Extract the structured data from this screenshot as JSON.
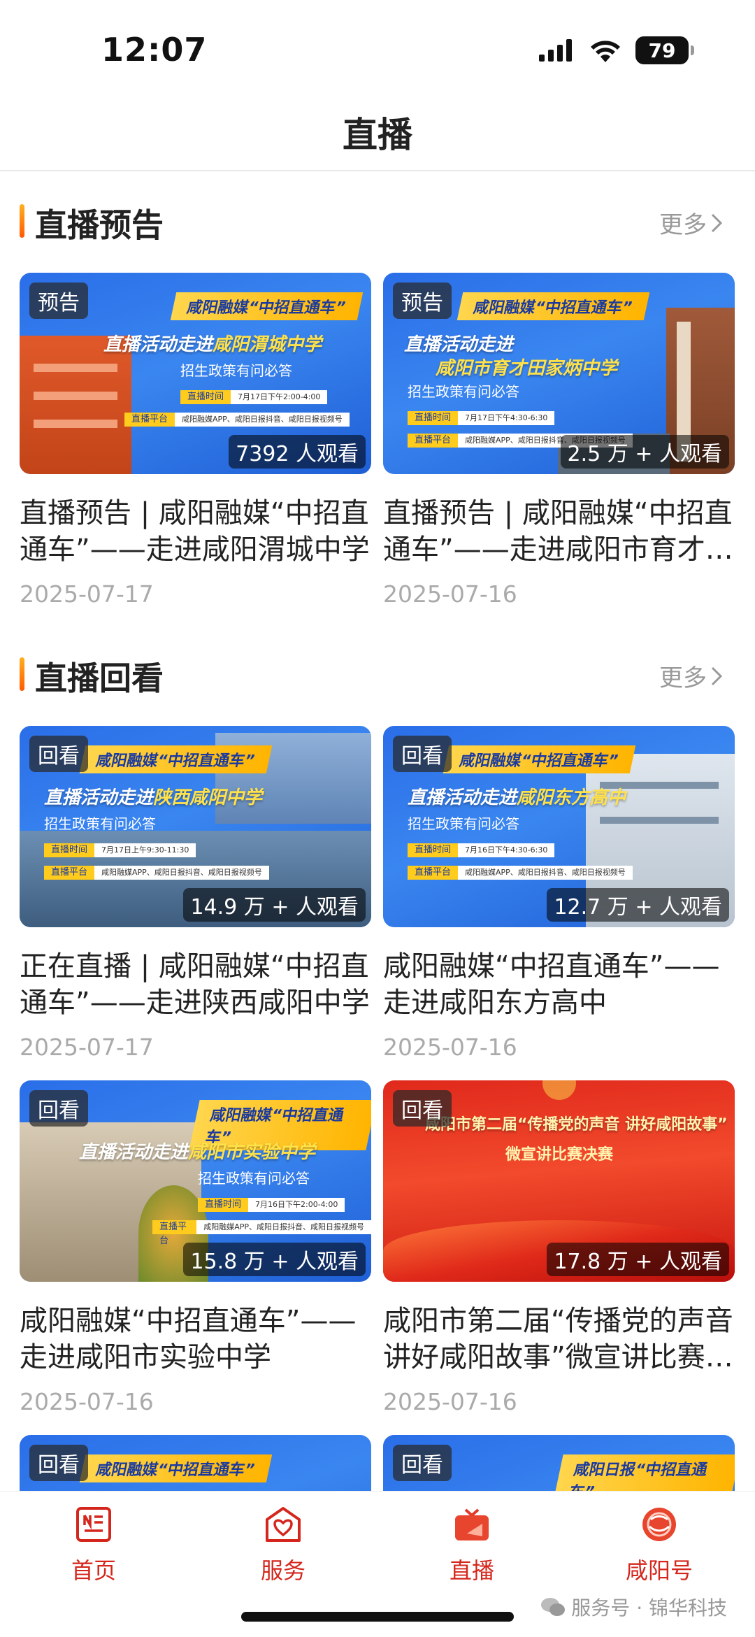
{
  "status": {
    "time": "12:07",
    "battery": "79"
  },
  "nav": {
    "title": "直播"
  },
  "sections": {
    "preview": {
      "title": "直播预告",
      "more": "更多"
    },
    "replay": {
      "title": "直播回看",
      "more": "更多"
    }
  },
  "cards": [
    {
      "badge": "预告",
      "viewers": "7392 人观看",
      "title": "直播预告 | 咸阳融媒“中招直通车”——走进咸阳渭城中学",
      "date": "2025-07-17",
      "banner": {
        "tag": "咸阳融媒“中招直通车”",
        "headline_prefix": "直播活动走进",
        "headline_highlight": "咸阳渭城中学",
        "subline": "招生政策有问必答",
        "time_label": "直播时间",
        "time_value": "7月17日下午2:00-4:00",
        "platform_label": "直播平台",
        "platform_value": "咸阳融媒APP、咸阳日报抖音、咸阳日报视频号"
      }
    },
    {
      "badge": "预告",
      "viewers": "2.5 万 + 人观看",
      "title": "直播预告 | 咸阳融媒“中招直通车”——走进咸阳市育才田家炳中学",
      "date": "2025-07-16",
      "banner": {
        "tag": "咸阳融媒“中招直通车”",
        "headline_prefix": "直播活动走进",
        "headline_highlight": "咸阳市育才田家炳中学",
        "subline": "招生政策有问必答",
        "time_label": "直播时间",
        "time_value": "7月17日下午4:30-6:30",
        "platform_label": "直播平台",
        "platform_value": "咸阳融媒APP、咸阳日报抖音、咸阳日报视频号"
      }
    },
    {
      "badge": "回看",
      "viewers": "14.9 万 + 人观看",
      "title": "正在直播 | 咸阳融媒“中招直通车”——走进陕西咸阳中学",
      "date": "2025-07-17",
      "banner": {
        "tag": "咸阳融媒“中招直通车”",
        "headline_prefix": "直播活动走进",
        "headline_highlight": "陕西咸阳中学",
        "subline": "招生政策有问必答",
        "time_label": "直播时间",
        "time_value": "7月17日上午9:30-11:30",
        "platform_label": "直播平台",
        "platform_value": "咸阳融媒APP、咸阳日报抖音、咸阳日报视频号"
      }
    },
    {
      "badge": "回看",
      "viewers": "12.7 万 + 人观看",
      "title": "咸阳融媒“中招直通车”——走进咸阳东方高中",
      "date": "2025-07-16",
      "banner": {
        "tag": "咸阳融媒“中招直通车”",
        "headline_prefix": "直播活动走进",
        "headline_highlight": "咸阳东方高中",
        "subline": "招生政策有问必答",
        "time_label": "直播时间",
        "time_value": "7月16日下午4:30-6:30",
        "platform_label": "直播平台",
        "platform_value": "咸阳融媒APP、咸阳日报抖音、咸阳日报视频号"
      }
    },
    {
      "badge": "回看",
      "viewers": "15.8 万 + 人观看",
      "title": "咸阳融媒“中招直通车”——走进咸阳市实验中学",
      "date": "2025-07-16",
      "banner": {
        "tag": "咸阳融媒“中招直通车”",
        "headline_prefix": "直播活动走进",
        "headline_highlight": "咸阳市实验中学",
        "subline": "招生政策有问必答",
        "time_label": "直播时间",
        "time_value": "7月16日下午2:00-4:00",
        "platform_label": "直播平台",
        "platform_value": "咸阳融媒APP、咸阳日报抖音、咸阳日报视频号"
      }
    },
    {
      "badge": "回看",
      "viewers": "17.8 万 + 人观看",
      "title": "咸阳市第二届“传播党的声音 讲好咸阳故事”微宣讲比赛决赛",
      "date": "2025-07-16",
      "banner": {
        "tag": "",
        "headline_prefix": "咸阳市第二届“传播党的声音 讲好咸阳故事”",
        "headline_highlight": "",
        "subline": "微宣讲比赛决赛",
        "time_label": "",
        "time_value": "",
        "platform_label": "",
        "platform_value": ""
      }
    },
    {
      "badge": "回看",
      "banner": {
        "tag": "咸阳融媒“中招直通车”"
      }
    },
    {
      "badge": "回看",
      "banner": {
        "tag": "咸阳日报“中招直通车”"
      }
    }
  ],
  "tabs": [
    {
      "label": "首页",
      "icon": "news-icon"
    },
    {
      "label": "服务",
      "icon": "heart-home-icon"
    },
    {
      "label": "直播",
      "icon": "tv-icon"
    },
    {
      "label": "咸阳号",
      "icon": "xianyang-logo-icon"
    }
  ],
  "watermark": "服务号 · 锦华科技",
  "colors": {
    "accent": "#d4261c",
    "section_bar": "#ff7a00",
    "banner_blue": "#2a6ee8",
    "banner_yellow": "#ffcc1e"
  }
}
